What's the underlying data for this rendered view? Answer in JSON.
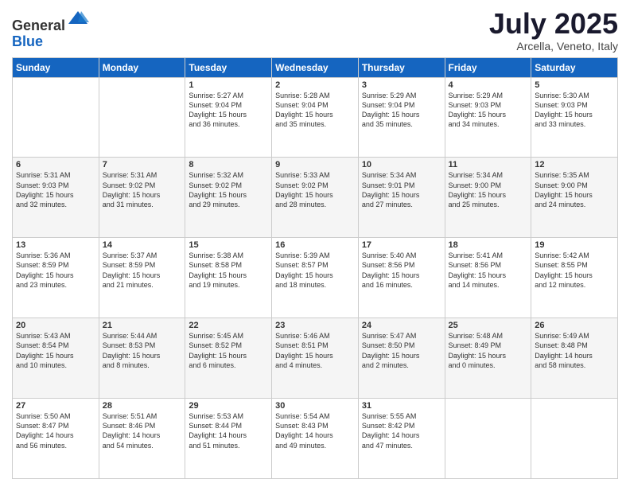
{
  "logo": {
    "general": "General",
    "blue": "Blue"
  },
  "header": {
    "month": "July 2025",
    "location": "Arcella, Veneto, Italy"
  },
  "weekdays": [
    "Sunday",
    "Monday",
    "Tuesday",
    "Wednesday",
    "Thursday",
    "Friday",
    "Saturday"
  ],
  "weeks": [
    [
      {
        "day": "",
        "content": ""
      },
      {
        "day": "",
        "content": ""
      },
      {
        "day": "1",
        "content": "Sunrise: 5:27 AM\nSunset: 9:04 PM\nDaylight: 15 hours\nand 36 minutes."
      },
      {
        "day": "2",
        "content": "Sunrise: 5:28 AM\nSunset: 9:04 PM\nDaylight: 15 hours\nand 35 minutes."
      },
      {
        "day": "3",
        "content": "Sunrise: 5:29 AM\nSunset: 9:04 PM\nDaylight: 15 hours\nand 35 minutes."
      },
      {
        "day": "4",
        "content": "Sunrise: 5:29 AM\nSunset: 9:03 PM\nDaylight: 15 hours\nand 34 minutes."
      },
      {
        "day": "5",
        "content": "Sunrise: 5:30 AM\nSunset: 9:03 PM\nDaylight: 15 hours\nand 33 minutes."
      }
    ],
    [
      {
        "day": "6",
        "content": "Sunrise: 5:31 AM\nSunset: 9:03 PM\nDaylight: 15 hours\nand 32 minutes."
      },
      {
        "day": "7",
        "content": "Sunrise: 5:31 AM\nSunset: 9:02 PM\nDaylight: 15 hours\nand 31 minutes."
      },
      {
        "day": "8",
        "content": "Sunrise: 5:32 AM\nSunset: 9:02 PM\nDaylight: 15 hours\nand 29 minutes."
      },
      {
        "day": "9",
        "content": "Sunrise: 5:33 AM\nSunset: 9:02 PM\nDaylight: 15 hours\nand 28 minutes."
      },
      {
        "day": "10",
        "content": "Sunrise: 5:34 AM\nSunset: 9:01 PM\nDaylight: 15 hours\nand 27 minutes."
      },
      {
        "day": "11",
        "content": "Sunrise: 5:34 AM\nSunset: 9:00 PM\nDaylight: 15 hours\nand 25 minutes."
      },
      {
        "day": "12",
        "content": "Sunrise: 5:35 AM\nSunset: 9:00 PM\nDaylight: 15 hours\nand 24 minutes."
      }
    ],
    [
      {
        "day": "13",
        "content": "Sunrise: 5:36 AM\nSunset: 8:59 PM\nDaylight: 15 hours\nand 23 minutes."
      },
      {
        "day": "14",
        "content": "Sunrise: 5:37 AM\nSunset: 8:59 PM\nDaylight: 15 hours\nand 21 minutes."
      },
      {
        "day": "15",
        "content": "Sunrise: 5:38 AM\nSunset: 8:58 PM\nDaylight: 15 hours\nand 19 minutes."
      },
      {
        "day": "16",
        "content": "Sunrise: 5:39 AM\nSunset: 8:57 PM\nDaylight: 15 hours\nand 18 minutes."
      },
      {
        "day": "17",
        "content": "Sunrise: 5:40 AM\nSunset: 8:56 PM\nDaylight: 15 hours\nand 16 minutes."
      },
      {
        "day": "18",
        "content": "Sunrise: 5:41 AM\nSunset: 8:56 PM\nDaylight: 15 hours\nand 14 minutes."
      },
      {
        "day": "19",
        "content": "Sunrise: 5:42 AM\nSunset: 8:55 PM\nDaylight: 15 hours\nand 12 minutes."
      }
    ],
    [
      {
        "day": "20",
        "content": "Sunrise: 5:43 AM\nSunset: 8:54 PM\nDaylight: 15 hours\nand 10 minutes."
      },
      {
        "day": "21",
        "content": "Sunrise: 5:44 AM\nSunset: 8:53 PM\nDaylight: 15 hours\nand 8 minutes."
      },
      {
        "day": "22",
        "content": "Sunrise: 5:45 AM\nSunset: 8:52 PM\nDaylight: 15 hours\nand 6 minutes."
      },
      {
        "day": "23",
        "content": "Sunrise: 5:46 AM\nSunset: 8:51 PM\nDaylight: 15 hours\nand 4 minutes."
      },
      {
        "day": "24",
        "content": "Sunrise: 5:47 AM\nSunset: 8:50 PM\nDaylight: 15 hours\nand 2 minutes."
      },
      {
        "day": "25",
        "content": "Sunrise: 5:48 AM\nSunset: 8:49 PM\nDaylight: 15 hours\nand 0 minutes."
      },
      {
        "day": "26",
        "content": "Sunrise: 5:49 AM\nSunset: 8:48 PM\nDaylight: 14 hours\nand 58 minutes."
      }
    ],
    [
      {
        "day": "27",
        "content": "Sunrise: 5:50 AM\nSunset: 8:47 PM\nDaylight: 14 hours\nand 56 minutes."
      },
      {
        "day": "28",
        "content": "Sunrise: 5:51 AM\nSunset: 8:46 PM\nDaylight: 14 hours\nand 54 minutes."
      },
      {
        "day": "29",
        "content": "Sunrise: 5:53 AM\nSunset: 8:44 PM\nDaylight: 14 hours\nand 51 minutes."
      },
      {
        "day": "30",
        "content": "Sunrise: 5:54 AM\nSunset: 8:43 PM\nDaylight: 14 hours\nand 49 minutes."
      },
      {
        "day": "31",
        "content": "Sunrise: 5:55 AM\nSunset: 8:42 PM\nDaylight: 14 hours\nand 47 minutes."
      },
      {
        "day": "",
        "content": ""
      },
      {
        "day": "",
        "content": ""
      }
    ]
  ]
}
